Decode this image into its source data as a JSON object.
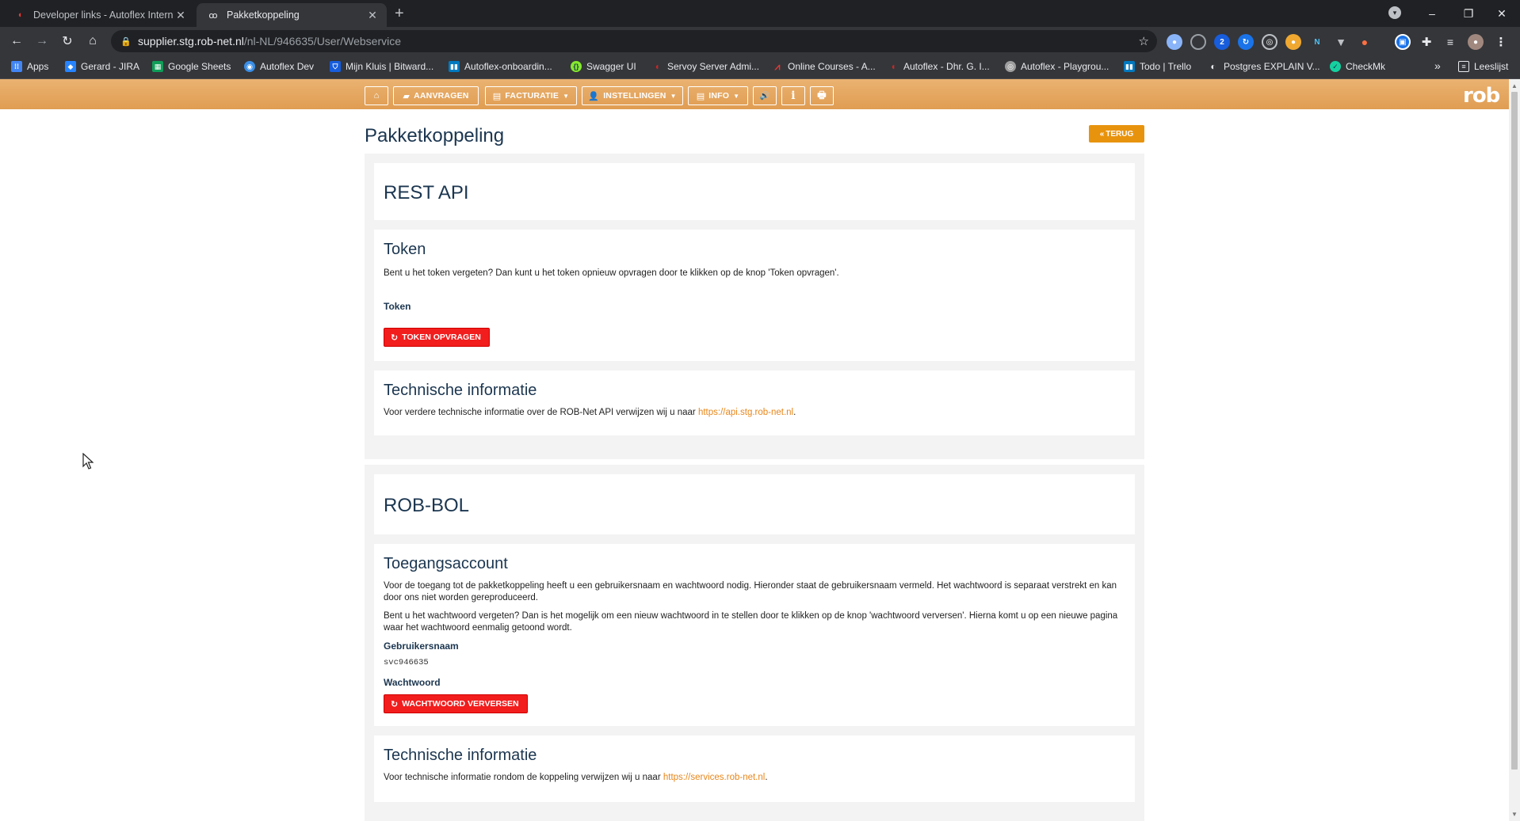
{
  "browser": {
    "tabs": [
      {
        "title": "Developer links - Autoflex Intern",
        "active": false
      },
      {
        "title": "Pakketkoppeling",
        "active": true
      }
    ],
    "new_tab": "+",
    "window_controls": {
      "minimize": "–",
      "restore": "❐",
      "close": "✕"
    },
    "address": {
      "host": "supplier.stg.rob-net.nl",
      "path": "/nl-NL/946635/User/Webservice"
    },
    "bookmarks": [
      {
        "label": "Apps",
        "icon": "apps-grid-icon",
        "color": "#4285f4"
      },
      {
        "label": "Gerard - JIRA",
        "icon": "jira-icon",
        "color": "#2684ff"
      },
      {
        "label": "Google Sheets",
        "icon": "sheets-icon",
        "color": "#0f9d58"
      },
      {
        "label": "Autoflex Dev",
        "icon": "autoflex-icon",
        "color": "#3a8ee6"
      },
      {
        "label": "Mijn Kluis | Bitward...",
        "icon": "bitwarden-icon",
        "color": "#175ddc"
      },
      {
        "label": "Autoflex-onboardin...",
        "icon": "trello-icon",
        "color": "#0079bf"
      },
      {
        "label": "Swagger UI",
        "icon": "swagger-icon",
        "color": "#85ea2d"
      },
      {
        "label": "Servoy Server Admi...",
        "icon": "servoy-icon",
        "color": "#c62828"
      },
      {
        "label": "Online Courses - A...",
        "icon": "courses-icon",
        "color": "#e53935"
      },
      {
        "label": "Autoflex - Dhr. G. I...",
        "icon": "autoflex-red-icon",
        "color": "#c62828"
      },
      {
        "label": "Autoflex - Playgrou...",
        "icon": "playground-icon",
        "color": "#9e9e9e"
      },
      {
        "label": "Todo | Trello",
        "icon": "trello-icon",
        "color": "#0079bf"
      },
      {
        "label": "Postgres EXPLAIN V...",
        "icon": "postgres-icon",
        "color": "#5f6368"
      },
      {
        "label": "CheckMk",
        "icon": "checkmk-icon",
        "color": "#15d1a0"
      }
    ],
    "bookmarks_overflow": "»",
    "reading_list": "Leeslijst"
  },
  "site": {
    "nav": [
      {
        "id": "home",
        "label": "",
        "icon": "⌂"
      },
      {
        "id": "aanvragen",
        "label": "AANVRAGEN",
        "icon": "▰"
      },
      {
        "id": "facturatie",
        "label": "FACTURATIE",
        "icon": "▤",
        "dropdown": true
      },
      {
        "id": "instellingen",
        "label": "INSTELLINGEN",
        "icon": "👤",
        "dropdown": true
      },
      {
        "id": "info",
        "label": "INFO",
        "icon": "▤",
        "dropdown": true
      },
      {
        "id": "speaker",
        "label": "",
        "icon": "🔊"
      },
      {
        "id": "about",
        "label": "",
        "icon": "i"
      },
      {
        "id": "print",
        "label": "",
        "icon": "🖶"
      }
    ],
    "logo": "rob",
    "accent_color": "#e8a964",
    "danger_color": "#f21d1d"
  },
  "page": {
    "title": "Pakketkoppeling",
    "back_label": "TERUG",
    "rest_api": {
      "heading": "REST API",
      "token_card": {
        "heading": "Token",
        "description": "Bent u het token vergeten? Dan kunt u het token opnieuw opvragen door te klikken op de knop 'Token opvragen'.",
        "field_label": "Token",
        "button_label": "TOKEN OPVRAGEN"
      },
      "tech_card": {
        "heading": "Technische informatie",
        "text_before": "Voor verdere technische informatie over de ROB-Net API verwijzen wij u naar ",
        "link": "https://api.stg.rob-net.nl",
        "text_after": "."
      }
    },
    "rob_bol": {
      "heading": "ROB-BOL",
      "account_card": {
        "heading": "Toegangsaccount",
        "paragraph1": "Voor de toegang tot de pakketkoppeling heeft u een gebruikersnaam en wachtwoord nodig. Hieronder staat de gebruikersnaam vermeld. Het wachtwoord is separaat verstrekt en kan door ons niet worden gereproduceerd.",
        "paragraph2": "Bent u het wachtwoord vergeten? Dan is het mogelijk om een nieuw wachtwoord in te stellen door te klikken op de knop 'wachtwoord verversen'. Hierna komt u op een nieuwe pagina waar het wachtwoord eenmalig getoond wordt.",
        "username_label": "Gebruikersnaam",
        "username_value": "svc946635",
        "password_label": "Wachtwoord",
        "button_label": "WACHTWOORD VERVERSEN"
      },
      "tech_card": {
        "heading": "Technische informatie",
        "text_before": "Voor technische informatie rondom de koppeling verwijzen wij u naar ",
        "link": "https://services.rob-net.nl",
        "text_after": "."
      }
    }
  }
}
